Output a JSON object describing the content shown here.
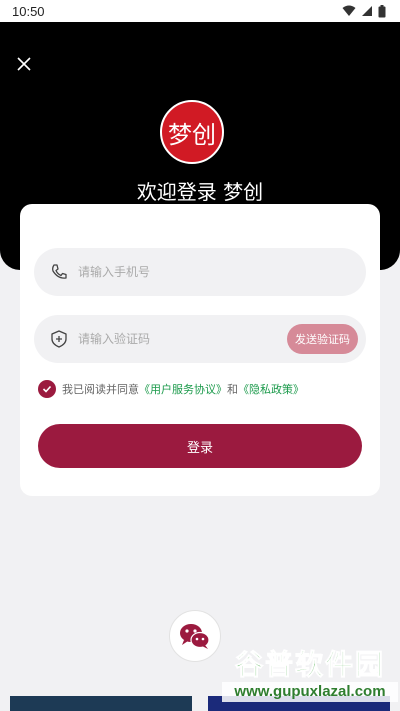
{
  "status_bar": {
    "time": "10:50"
  },
  "header": {
    "logo_text": "梦创",
    "welcome": "欢迎登录 梦创"
  },
  "form": {
    "phone_placeholder": "请输入手机号",
    "code_placeholder": "请输入验证码",
    "send_code_label": "发送验证码",
    "agree_prefix": "我已阅读并同意",
    "user_agreement": "《用户服务协议》",
    "and": "和",
    "privacy_policy": "《隐私政策》",
    "login_label": "登录",
    "agreed": true
  },
  "watermark": {
    "title": "谷普软件园",
    "url": "www.gupuxlazal.com"
  },
  "colors": {
    "brand": "#9b1a3f",
    "send_code_bg": "#d68a98",
    "link": "#1b9a4b",
    "hero_bg": "#000000"
  },
  "icons": [
    "close-icon",
    "phone-icon",
    "shield-plus-icon",
    "check-icon",
    "wechat-icon",
    "wifi-icon",
    "signal-icon",
    "battery-icon"
  ]
}
